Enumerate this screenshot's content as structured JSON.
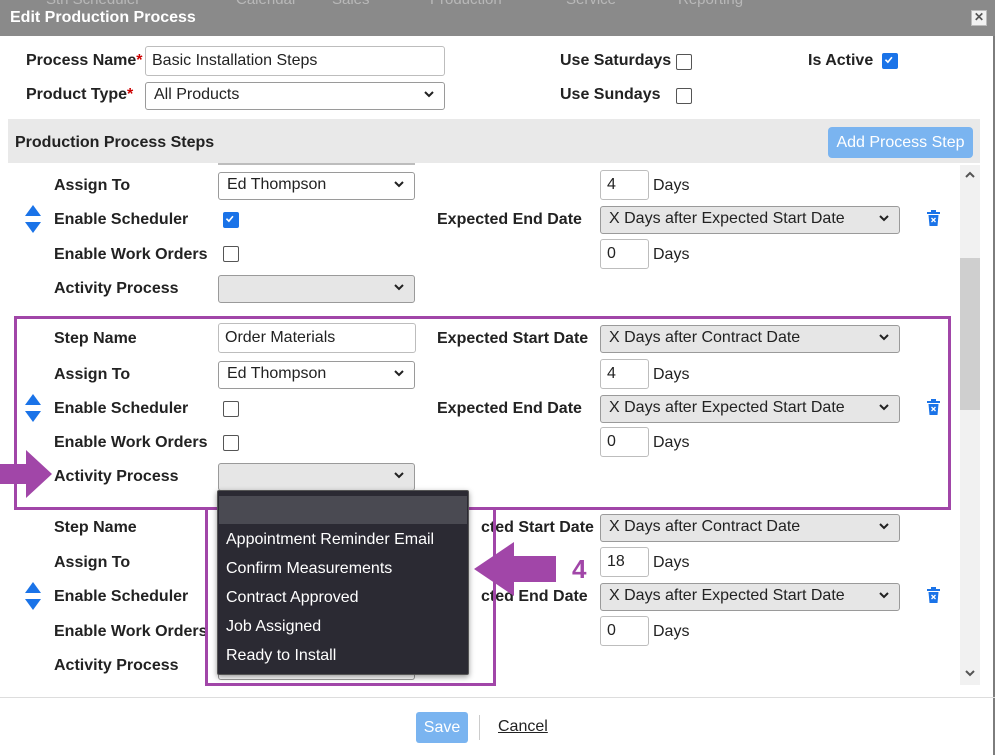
{
  "window": {
    "title": "Edit Production Process",
    "close_glyph": "✕",
    "background_nav": [
      "Stn Scheduler",
      "Calendar",
      "Sales",
      "Production",
      "Service",
      "Reporting"
    ]
  },
  "header": {
    "process_name_label": "Process Name",
    "process_name_value": "Basic Installation Steps",
    "product_type_label": "Product Type",
    "product_type_value": "All Products",
    "required_mark": "*",
    "use_saturdays_label": "Use Saturdays",
    "use_saturdays_checked": false,
    "use_sundays_label": "Use Sundays",
    "use_sundays_checked": false,
    "is_active_label": "Is Active",
    "is_active_checked": true
  },
  "section": {
    "title": "Production Process Steps",
    "add_button": "Add Process Step"
  },
  "labels": {
    "step_name": "Step Name",
    "assign_to": "Assign To",
    "enable_scheduler": "Enable Scheduler",
    "enable_work_orders": "Enable Work Orders",
    "activity_process": "Activity Process",
    "expected_start_date": "Expected Start Date",
    "expected_end_date": "Expected End Date",
    "expected_start_date_partial": "cted Start Date",
    "expected_end_date_partial": "cted End Date",
    "days": "Days"
  },
  "steps": [
    {
      "assign_to": "Ed Thompson",
      "enable_scheduler": true,
      "enable_work_orders": false,
      "activity_process": "",
      "start_days": "4",
      "end_date_option": "X Days after Expected Start Date",
      "end_days": "0"
    },
    {
      "step_name": "Order Materials",
      "assign_to": "Ed Thompson",
      "enable_scheduler": false,
      "enable_work_orders": false,
      "activity_process": "",
      "start_date_option": "X Days after Contract Date",
      "start_days": "4",
      "end_date_option": "X Days after Expected Start Date",
      "end_days": "0"
    },
    {
      "start_date_option": "X Days after Contract Date",
      "start_days": "18",
      "end_date_option": "X Days after Expected Start Date",
      "end_days": "0"
    }
  ],
  "dropdown": {
    "options": [
      "Appointment Reminder Email",
      "Confirm Measurements",
      "Contract Approved",
      "Job Assigned",
      "Ready to Install"
    ]
  },
  "annotation": {
    "number": "4",
    "color": "#a146a8"
  },
  "footer": {
    "save": "Save",
    "cancel": "Cancel"
  },
  "colors": {
    "accent": "#1a73e8",
    "button": "#7ab4f0",
    "titlebar": "#8a8a8a",
    "highlight": "#a146a8",
    "dropdown_bg": "#2b2a33"
  }
}
